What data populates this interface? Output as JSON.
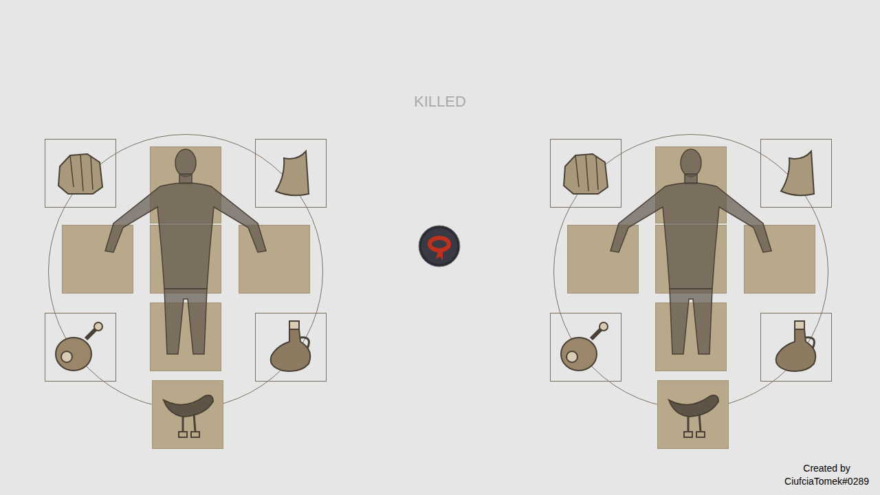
{
  "status": "KILLED",
  "credit": {
    "line1": "Created by",
    "line2": "CiufciaTomek#0289"
  },
  "panels": [
    {
      "slots": [
        {
          "kind": "armor"
        },
        {
          "kind": "cape"
        },
        {
          "kind": "head"
        },
        {
          "kind": "left-arm"
        },
        {
          "kind": "torso"
        },
        {
          "kind": "right-arm"
        },
        {
          "kind": "legs"
        },
        {
          "kind": "food"
        },
        {
          "kind": "potion"
        },
        {
          "kind": "saddle"
        }
      ]
    },
    {
      "slots": [
        {
          "kind": "armor"
        },
        {
          "kind": "cape"
        },
        {
          "kind": "head"
        },
        {
          "kind": "left-arm"
        },
        {
          "kind": "torso"
        },
        {
          "kind": "right-arm"
        },
        {
          "kind": "legs"
        },
        {
          "kind": "food"
        },
        {
          "kind": "potion"
        },
        {
          "kind": "saddle"
        }
      ]
    }
  ]
}
